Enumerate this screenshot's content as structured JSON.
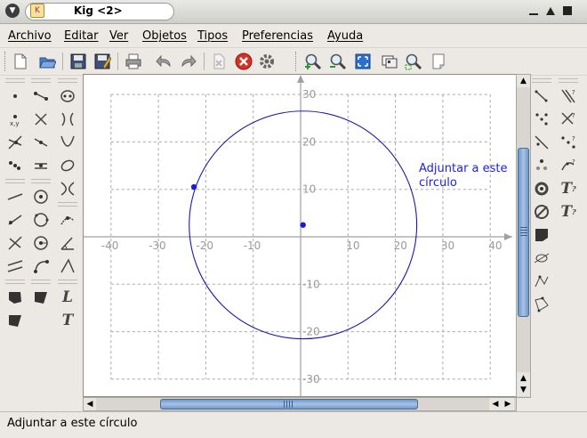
{
  "window": {
    "title": "Kig <2>",
    "controls": [
      "minimize-icon",
      "maximize-icon",
      "close-icon"
    ]
  },
  "menubar": {
    "items": [
      {
        "label": "Archivo"
      },
      {
        "label": "Editar"
      },
      {
        "label": "Ver"
      },
      {
        "label": "Objetos"
      },
      {
        "label": "Tipos"
      },
      {
        "label": "Preferencias"
      },
      {
        "label": "Ayuda"
      }
    ]
  },
  "toolbar": {
    "items": [
      "new-document-icon",
      "open-folder-icon",
      "save-icon",
      "save-as-icon",
      "print-icon",
      "undo-icon",
      "redo-icon",
      "delete-icon",
      "cancel-icon",
      "run-macro-icon",
      "zoom-in-icon",
      "zoom-out-icon",
      "fit-to-page-icon",
      "full-screen-icon",
      "zoom-area-icon",
      "script-icon"
    ]
  },
  "palettes": {
    "left": [
      "point-icon",
      "segment-icon",
      "circle-by-center-icon",
      "line-icon",
      "label-icon"
    ],
    "right": [
      "vector-icon",
      "transform-icon",
      "conic-icon",
      "text-label-icon",
      "locus-icon"
    ]
  },
  "canvas": {
    "x_ticks": [
      "-40",
      "-30",
      "-20",
      "-10",
      "10",
      "20",
      "30",
      "40"
    ],
    "y_ticks": [
      "30",
      "20",
      "10",
      "-10",
      "-20",
      "-30"
    ],
    "circle": {
      "center_data": [
        0.5,
        2.5
      ],
      "radius_data": 24,
      "color": "#1a1aa8"
    },
    "points": [
      {
        "name": "center",
        "x_data": 0.5,
        "y_data": 2.5
      },
      {
        "name": "radius-point",
        "x_data": -22.5,
        "y_data": 10.5
      }
    ],
    "hover_label": "Adjuntar a este\ncírculo",
    "axis_color": "#a0a0a0",
    "grid_color": "#a8a8a8"
  },
  "statusbar": {
    "text": "Adjuntar a este círculo"
  }
}
